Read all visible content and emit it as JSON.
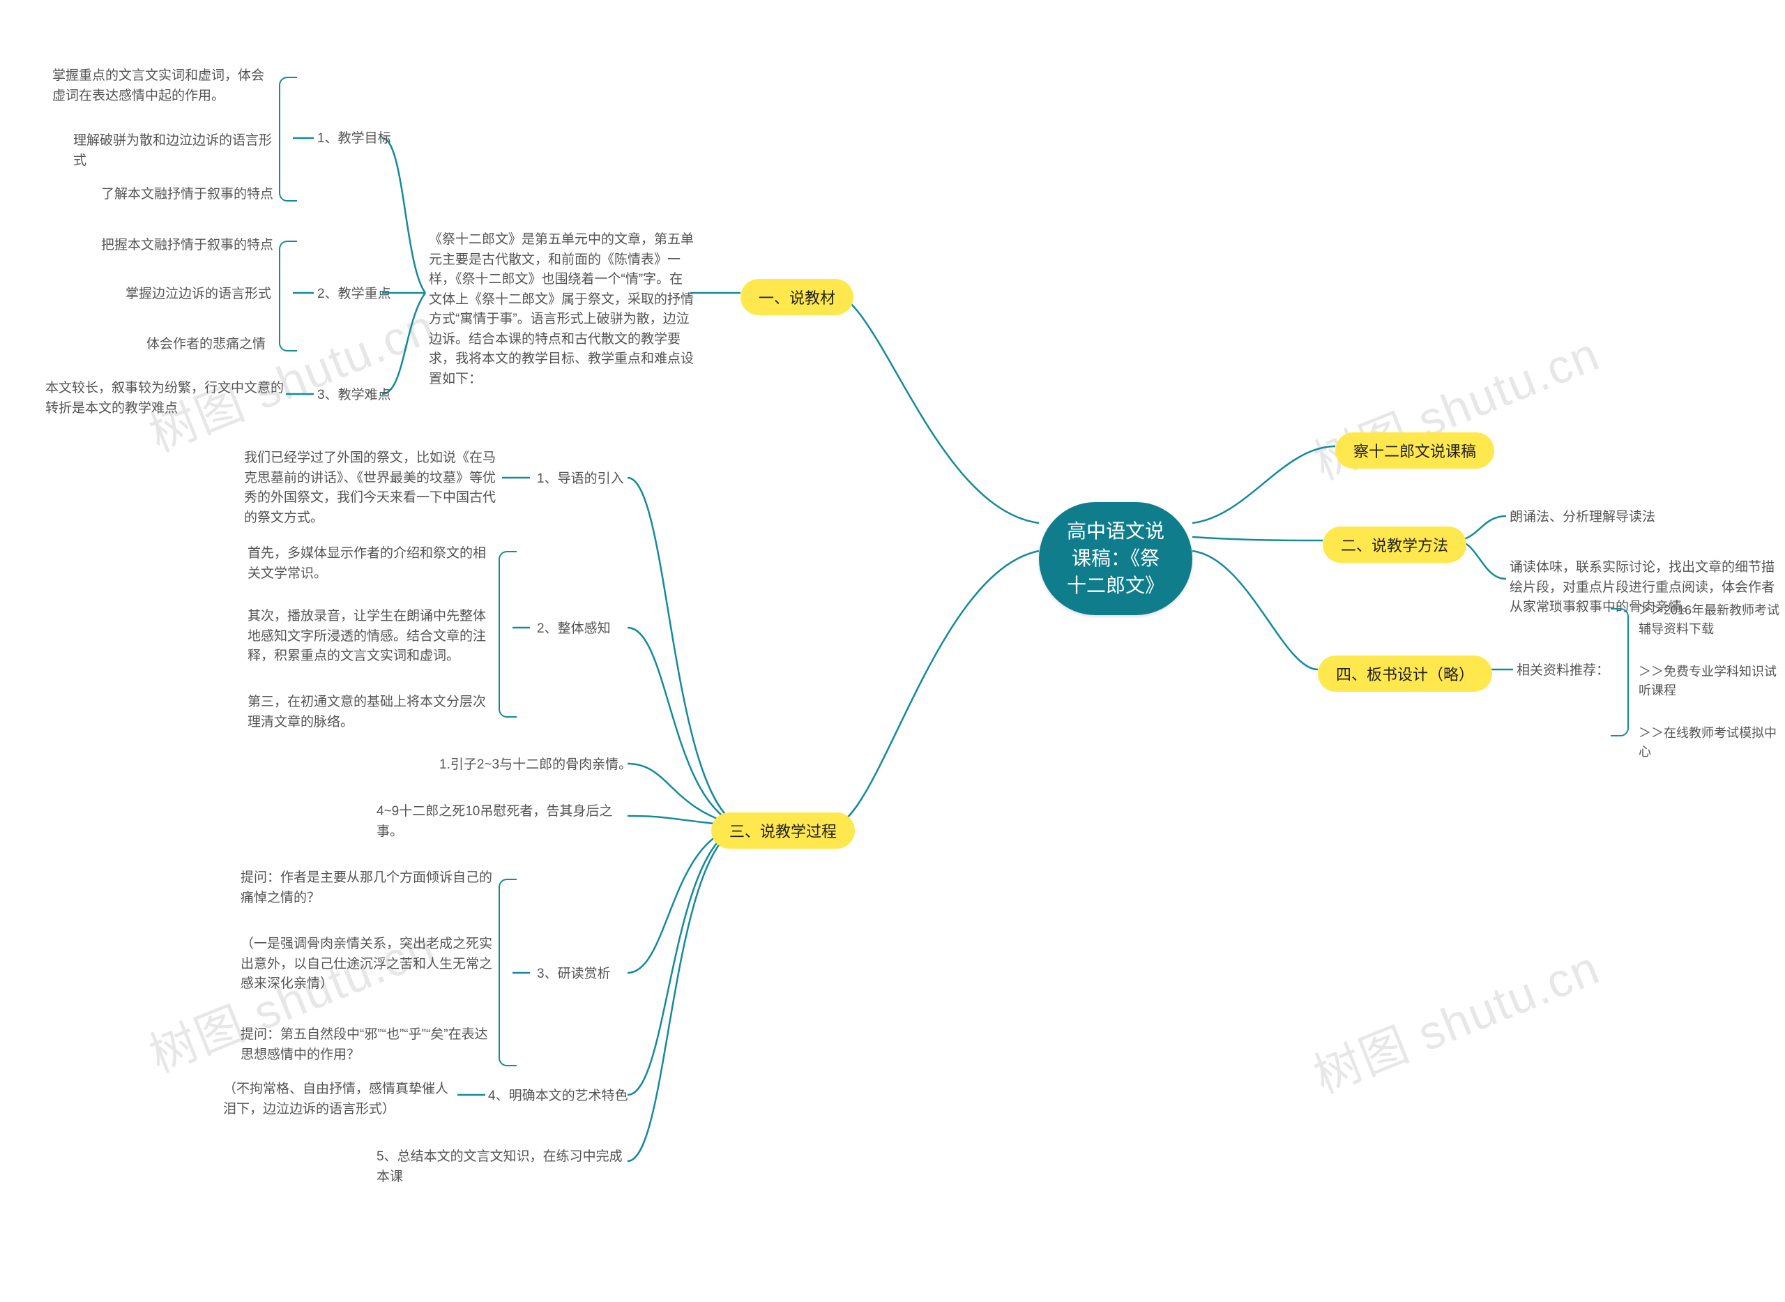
{
  "root": "高中语文说课稿：《祭十二郎文》",
  "right": {
    "title_node": "察十二郎文说课稿",
    "sec2_label": "二、说教学方法",
    "sec2_leaf1": "朗诵法、分析理解导读法",
    "sec2_leaf2": "诵读体味，联系实际讨论，找出文章的细节描绘片段，对重点片段进行重点阅读，体会作者从家常琐事叙事中的骨肉亲情。",
    "sec4_label": "四、板书设计（略）",
    "sec4_sub": "相关资料推荐：",
    "sec4_l1": "＞＞2016年最新教师考试辅导资料下载",
    "sec4_l2": "＞＞免费专业学科知识试听课程",
    "sec4_l3": "＞＞在线教师考试模拟中心"
  },
  "left": {
    "sec1_label": "一、说教材",
    "sec1_desc": "《祭十二郎文》是第五单元中的文章，第五单元主要是古代散文，和前面的《陈情表》一样，《祭十二郎文》也围绕着一个“情”字。在文体上《祭十二郎文》属于祭文，采取的抒情方式“寓情于事”。语言形式上破骈为散，边泣边诉。结合本课的特点和古代散文的教学要求，我将本文的教学目标、教学重点和难点设置如下：",
    "sec1_sub1": "1、教学目标",
    "sec1_sub1_l1": "掌握重点的文言文实词和虚词，体会虚词在表达感情中起的作用。",
    "sec1_sub1_l2": "理解破骈为散和边泣边诉的语言形式",
    "sec1_sub1_l3": "了解本文融抒情于叙事的特点",
    "sec1_sub2": "2、教学重点",
    "sec1_sub2_l1": "把握本文融抒情于叙事的特点",
    "sec1_sub2_l2": "掌握边泣边诉的语言形式",
    "sec1_sub2_l3": "体会作者的悲痛之情",
    "sec1_sub3": "3、教学难点",
    "sec1_sub3_l1": "本文较长，叙事较为纷繁，行文中文意的转折是本文的教学难点",
    "sec3_label": "三、说教学过程",
    "sec3_sub1": "1、导语的引入",
    "sec3_sub1_l1": "我们已经学过了外国的祭文，比如说《在马克思墓前的讲话》、《世界最美的坟墓》等优秀的外国祭文，我们今天来看一下中国古代的祭文方式。",
    "sec3_sub2": "2、整体感知",
    "sec3_sub2_l1": "首先，多媒体显示作者的介绍和祭文的相关文学常识。",
    "sec3_sub2_l2": "其次，播放录音，让学生在朗诵中先整体地感知文字所浸透的情感。结合文章的注释，积累重点的文言文实词和虚词。",
    "sec3_sub2_l3": "第三，在初通文意的基础上将本文分层次理清文章的脉络。",
    "sec3_inline1": "1.引子2~3与十二郎的骨肉亲情。",
    "sec3_inline2": "4~9十二郎之死10吊慰死者，告其身后之事。",
    "sec3_sub3": "3、研读赏析",
    "sec3_sub3_l1": "提问：作者是主要从那几个方面倾诉自己的痛悼之情的？",
    "sec3_sub3_l2": "（一是强调骨肉亲情关系，突出老成之死实出意外，以自己仕途沉浮之苦和人生无常之感来深化亲情）",
    "sec3_sub3_l3": "提问：第五自然段中“邪”“也”“乎”“矣”在表达思想感情中的作用？",
    "sec3_sub4": "4、明确本文的艺术特色",
    "sec3_sub4_l1": "（不拘常格、自由抒情，感情真挚催人泪下，边泣边诉的语言形式）",
    "sec3_sub5": "5、总结本文的文言文知识，在练习中完成本课"
  },
  "watermark": "树图 shutu.cn"
}
